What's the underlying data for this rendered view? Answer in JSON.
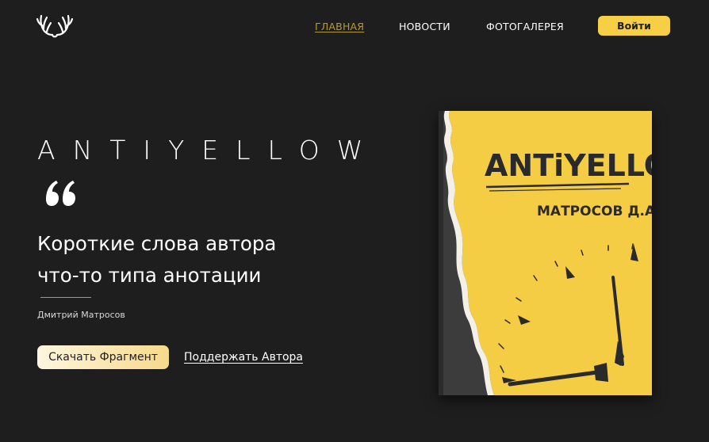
{
  "header": {
    "logo_icon": "deer-antlers-icon",
    "nav": [
      {
        "label": "ГЛАВНАЯ",
        "active": true
      },
      {
        "label": "НОВОСТИ",
        "active": false
      },
      {
        "label": "ФОТОГАЛЕРЕЯ",
        "active": false
      }
    ],
    "login_label": "Войти"
  },
  "hero": {
    "title": "ANTIYELLOW",
    "quote_icon": "quote-icon",
    "tagline_line1": "Короткие слова автора",
    "tagline_line2": "что-то типа анотации",
    "author": "Дмитрий Матросов",
    "download_label": "Скачать Фрагмент",
    "support_label": "Поддержать Автора"
  },
  "book": {
    "title": "ANTiYELLOW",
    "author": "МАТРОСОВ Д.А."
  },
  "colors": {
    "background": "#1f1e1e",
    "accent_yellow": "#f6cf45",
    "active_nav": "#b79a2f",
    "cover_yellow": "#f5cd45",
    "cover_dark": "#3d3c3c"
  }
}
